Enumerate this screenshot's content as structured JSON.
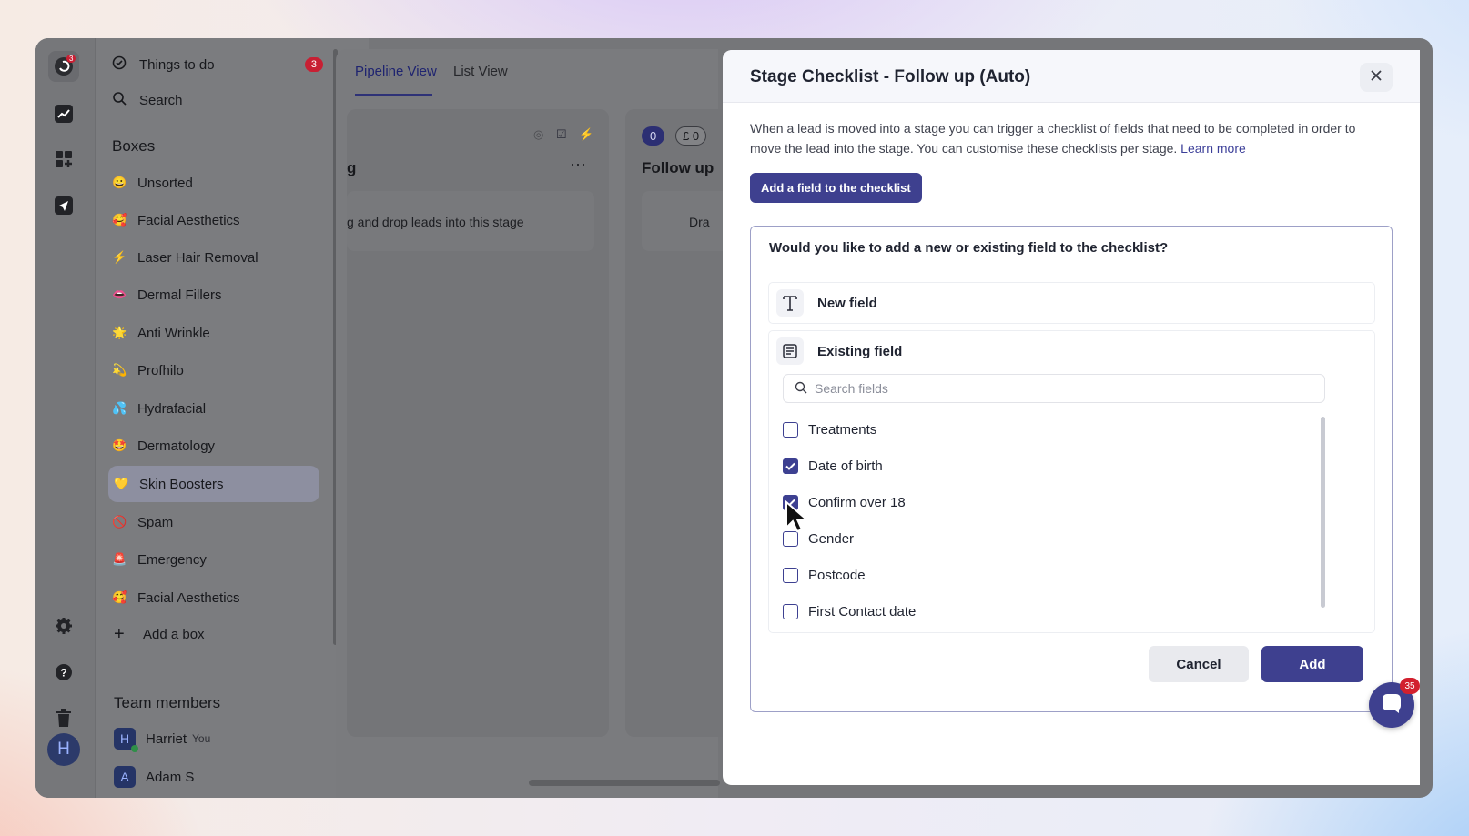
{
  "sidebar": {
    "things_to_do": "Things to do",
    "things_to_do_count": "3",
    "search": "Search",
    "boxes_heading": "Boxes",
    "boxes": [
      {
        "emoji": "😀",
        "label": "Unsorted"
      },
      {
        "emoji": "🥰",
        "label": "Facial Aesthetics"
      },
      {
        "emoji": "⚡",
        "label": "Laser Hair Removal"
      },
      {
        "emoji": "👄",
        "label": "Dermal Fillers"
      },
      {
        "emoji": "🌟",
        "label": "Anti Wrinkle"
      },
      {
        "emoji": "💫",
        "label": "Profhilo"
      },
      {
        "emoji": "💦",
        "label": "Hydrafacial"
      },
      {
        "emoji": "🤩",
        "label": "Dermatology"
      },
      {
        "emoji": "💛",
        "label": "Skin Boosters"
      },
      {
        "emoji": "🚫",
        "label": "Spam"
      },
      {
        "emoji": "🚨",
        "label": "Emergency"
      },
      {
        "emoji": "🥰",
        "label": "Facial Aesthetics"
      }
    ],
    "add_box": "Add a box",
    "team_heading": "Team members",
    "members": [
      {
        "initial": "H",
        "name": "Harriet",
        "tag": "You"
      },
      {
        "initial": "A",
        "name": "Adam S",
        "tag": ""
      }
    ],
    "rail_badge": "3",
    "user_initial": "H"
  },
  "board": {
    "tabs": [
      "Pipeline View",
      "List View"
    ],
    "col1_title": "g",
    "col1_menu": "···",
    "col1_empty": "g and drop leads into this stage",
    "col2_count": "0",
    "col2_value": "£ 0",
    "col2_title": "Follow up",
    "col2_empty": "Dra"
  },
  "modal": {
    "title": "Stage Checklist - Follow up (Auto)",
    "description": "When a lead is moved into a stage you can trigger a checklist of fields that need to be completed in order to move the lead into the stage. You can customise these checklists per stage.",
    "learn_more": "Learn more",
    "add_field_button": "Add a field to the checklist",
    "question": "Would you like to add a new or existing field to the checklist?",
    "new_field": "New field",
    "existing_field": "Existing field",
    "search_placeholder": "Search fields",
    "fields": [
      {
        "label": "Treatments",
        "checked": false
      },
      {
        "label": "Date of birth",
        "checked": true
      },
      {
        "label": "Confirm over 18",
        "checked": true
      },
      {
        "label": "Gender",
        "checked": false
      },
      {
        "label": "Postcode",
        "checked": false
      },
      {
        "label": "First Contact date",
        "checked": false
      }
    ],
    "cancel": "Cancel",
    "add": "Add"
  },
  "chat": {
    "badge": "35"
  },
  "colors": {
    "primary": "#3e408f",
    "badge_red": "#c81f33",
    "overlay_gray": "#757679"
  }
}
